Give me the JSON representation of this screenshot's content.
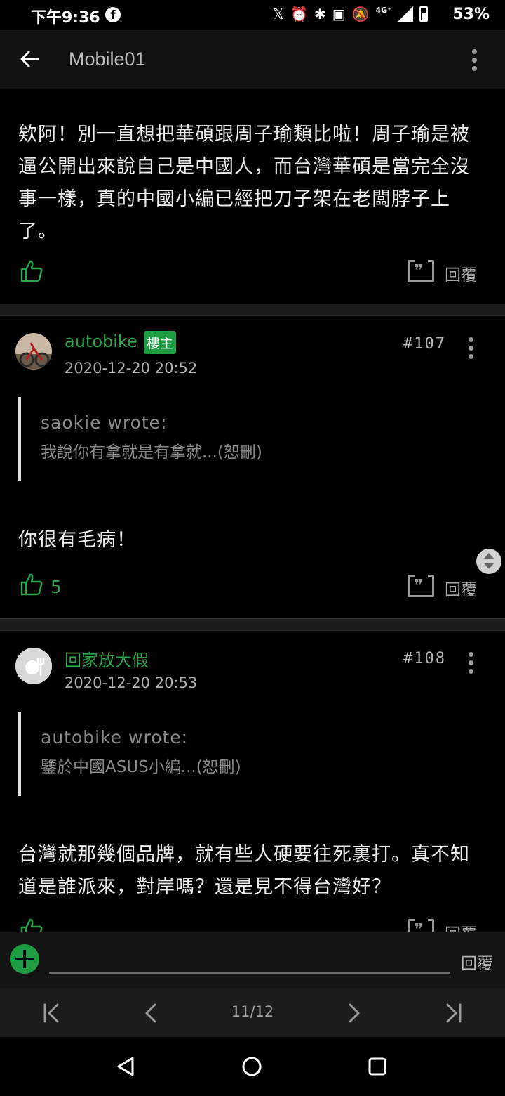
{
  "status": {
    "time": "下午9:36",
    "network": "4G⁺",
    "battery": "53%"
  },
  "appbar": {
    "title": "Mobile01"
  },
  "posts": [
    {
      "text": "欸阿！別一直想把華碩跟周子瑜類比啦！周子瑜是被逼公開出來說自己是中國人，而台灣華碩是當完全沒事一樣，真的中國小編已經把刀子架在老闆脖子上了。",
      "reply_label": "回覆"
    },
    {
      "author": "autobike",
      "badge": "樓主",
      "date": "2020-12-20 20:52",
      "floor": "#107",
      "quote_author": "saokie wrote:",
      "quote_text": "我說你有拿就是有拿就...(恕刪)",
      "text": "你很有毛病！",
      "likes": "5",
      "reply_label": "回覆"
    },
    {
      "author": "回家放大假",
      "date": "2020-12-20 20:53",
      "floor": "#108",
      "quote_author": "autobike wrote:",
      "quote_text": "鑒於中國ASUS小編...(恕刪)",
      "text": "台灣就那幾個品牌，就有些人硬要往死裏打。真不知道是誰派來，對岸嗎？還是見不得台灣好？",
      "reply_label": "回覆"
    }
  ],
  "reply_bar": {
    "placeholder": "",
    "send_label": "回覆"
  },
  "pager": {
    "current": "11/12"
  },
  "colors": {
    "accent": "#2ba34a",
    "badge": "#1f9c42"
  }
}
